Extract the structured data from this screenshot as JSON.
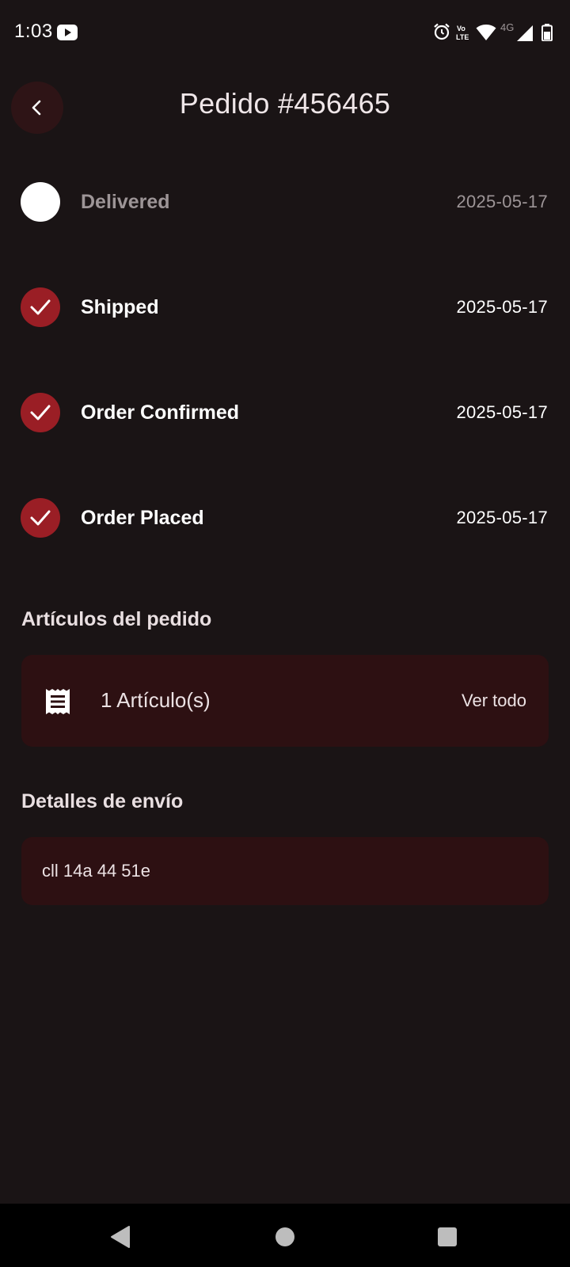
{
  "status_bar": {
    "time": "1:03",
    "network": "4G",
    "volte": "Vo LTE"
  },
  "header": {
    "title": "Pedido #456465"
  },
  "timeline": [
    {
      "label": "Delivered",
      "date": "2025-05-17",
      "completed": false
    },
    {
      "label": "Shipped",
      "date": "2025-05-17",
      "completed": true
    },
    {
      "label": "Order Confirmed",
      "date": "2025-05-17",
      "completed": true
    },
    {
      "label": "Order Placed",
      "date": "2025-05-17",
      "completed": true
    }
  ],
  "order_items": {
    "heading": "Artículos del pedido",
    "count_label": "1 Artículo(s)",
    "see_all_label": "Ver todo",
    "icon": "receipt-icon"
  },
  "shipping": {
    "heading": "Detalles de envío",
    "address": "cll 14a 44 51e"
  },
  "colors": {
    "background": "#1a1415",
    "card": "#2d1012",
    "accent": "#9a1e25",
    "back_button": "#2e1416"
  }
}
